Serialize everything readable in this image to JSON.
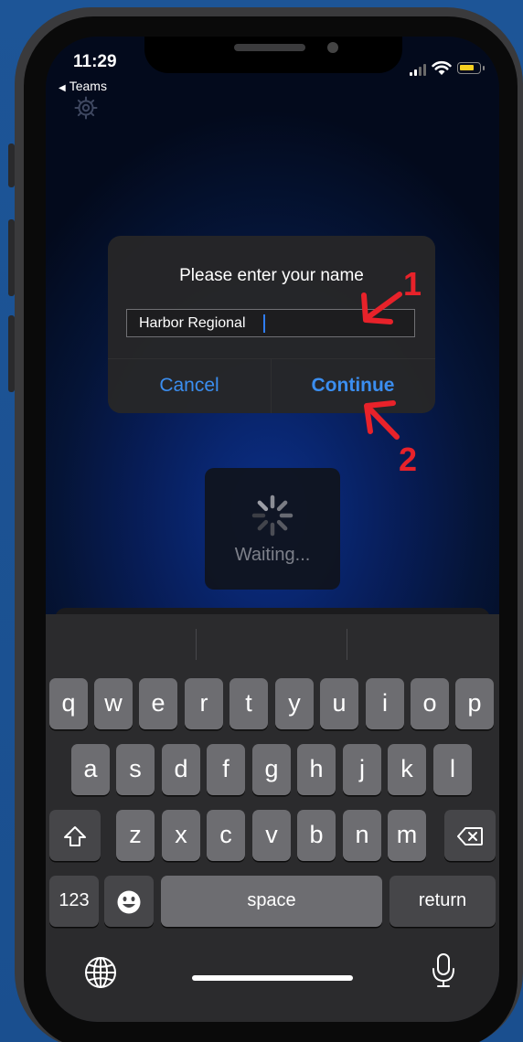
{
  "status_bar": {
    "time": "11:29",
    "back_label": "Teams"
  },
  "dialog": {
    "title": "Please enter your name",
    "input_value": "Harbor Regional",
    "cancel_label": "Cancel",
    "continue_label": "Continue"
  },
  "loading": {
    "label": "Waiting..."
  },
  "keyboard": {
    "row1": [
      "q",
      "w",
      "e",
      "r",
      "t",
      "y",
      "u",
      "i",
      "o",
      "p"
    ],
    "row2": [
      "a",
      "s",
      "d",
      "f",
      "g",
      "h",
      "j",
      "k",
      "l"
    ],
    "row3": [
      "z",
      "x",
      "c",
      "v",
      "b",
      "n",
      "m"
    ],
    "numbers_label": "123",
    "space_label": "space",
    "return_label": "return"
  },
  "annotations": {
    "step1": "1",
    "step2": "2",
    "color": "#e8222a"
  },
  "colors": {
    "accent": "#3b8ef0",
    "battery": "#f8d021",
    "background": "#1c5394"
  }
}
